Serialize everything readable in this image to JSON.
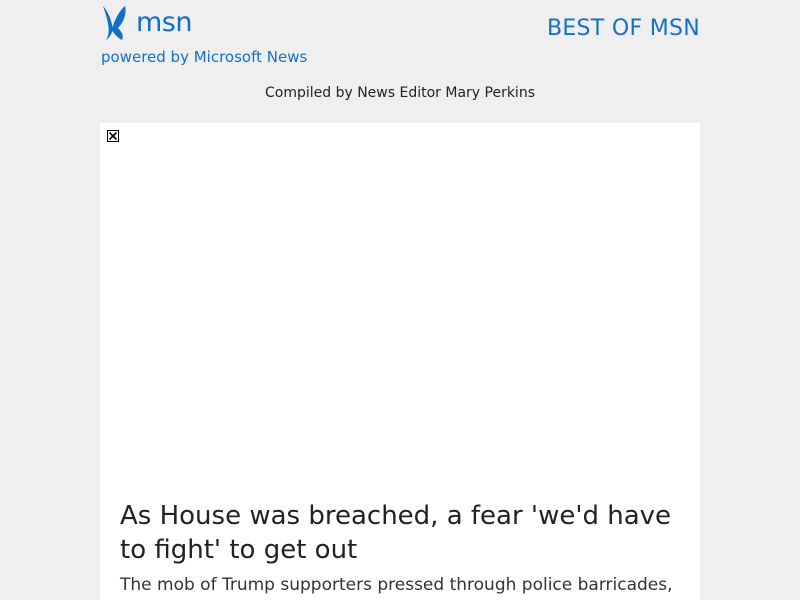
{
  "header": {
    "logo_text": "msn",
    "logo_icon": "msn-butterfly-icon",
    "powered_by": "powered by Microsoft News",
    "section_title": "BEST OF MSN",
    "compiled_by": "Compiled by News Editor Mary Perkins"
  },
  "article": {
    "image_icon": "broken-image-icon",
    "headline": "As House was breached, a fear 'we'd have to fight' to get out",
    "summary": "The mob of Trump supporters pressed through police barricades,"
  },
  "colors": {
    "brand_blue": "#1570c3",
    "background": "#efefef",
    "card": "#ffffff"
  }
}
